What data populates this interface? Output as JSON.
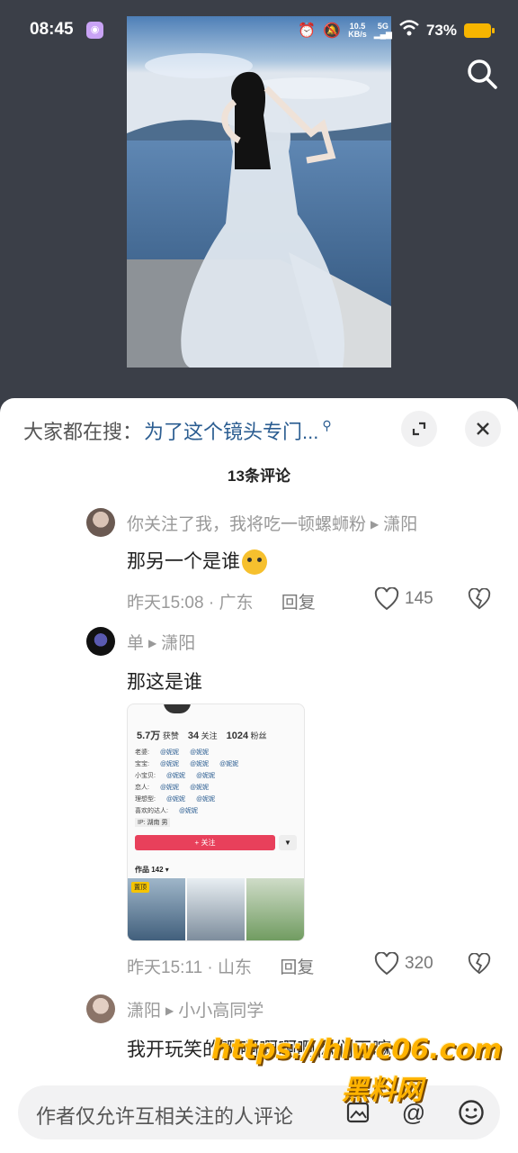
{
  "status_bar": {
    "time": "08:45",
    "net_speed_value": "10.5",
    "net_speed_unit": "KB/s",
    "network": "5G",
    "battery": "73%"
  },
  "header": {
    "search_icon": "search-icon"
  },
  "sheet": {
    "suggest_label": "大家都在搜：",
    "suggest_query": "为了这个镜头专门...",
    "comment_count": "13条评论"
  },
  "comments": [
    {
      "author": "你关注了我，我将吃一顿螺蛳粉",
      "reply_to": "潇阳",
      "text": "那另一个是谁",
      "time": "昨天15:08",
      "location": "广东",
      "reply_label": "回复",
      "likes": "145"
    },
    {
      "author": "单",
      "reply_to": "潇阳",
      "text": "那这是谁",
      "time": "昨天15:11",
      "location": "山东",
      "reply_label": "回复",
      "likes": "320"
    },
    {
      "author": "潇阳",
      "reply_to": "小小高同学",
      "text": "我开玩笑的啊啊啊啊啊你们干嘛"
    }
  ],
  "screenshot": {
    "likes_value": "5.7万",
    "likes_label": "获赞",
    "following_value": "34",
    "following_label": "关注",
    "fans_value": "1024",
    "fans_label": "粉丝",
    "rows": [
      "老婆:",
      "宝宝:",
      "小宝贝:",
      "恋人:",
      "理想型:",
      "喜欢的达人:"
    ],
    "tag": "@妮妮",
    "location_tag": "IP: 湖南  男",
    "follow_label": "+ 关注",
    "works_label": "作品 142 ▾",
    "pinned_label": "置顶"
  },
  "input": {
    "placeholder": "作者仅允许互相关注的人评论"
  },
  "watermark": {
    "url": "https://hlwc06.com",
    "name": "黑料网"
  },
  "colors": {
    "accent_link": "#2b5d91",
    "battery": "#f7b500",
    "follow": "#e8405b",
    "watermark": "#ffb300"
  }
}
